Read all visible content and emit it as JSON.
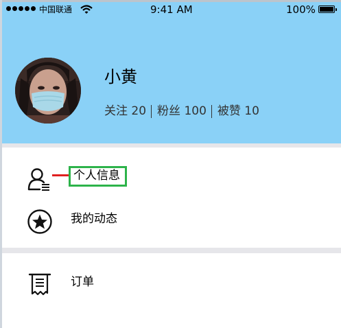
{
  "status_bar": {
    "carrier": "中国联通",
    "time": "9:41 AM",
    "battery": "100%"
  },
  "profile": {
    "name": "小黄",
    "stats": [
      {
        "label": "关注 20"
      },
      {
        "label": "粉丝 100"
      },
      {
        "label": "被赞 10"
      }
    ]
  },
  "menu": {
    "items": [
      {
        "label": "个人信息",
        "icon": "user-info-icon"
      },
      {
        "label": "我的动态",
        "icon": "star-circle-icon"
      },
      {
        "label": "订单",
        "icon": "receipt-icon"
      }
    ]
  },
  "colors": {
    "header_bg": "#8ad1f7",
    "highlight_border": "#2db34a",
    "callout_line": "#e02020",
    "separator": "#e6e6ea"
  }
}
